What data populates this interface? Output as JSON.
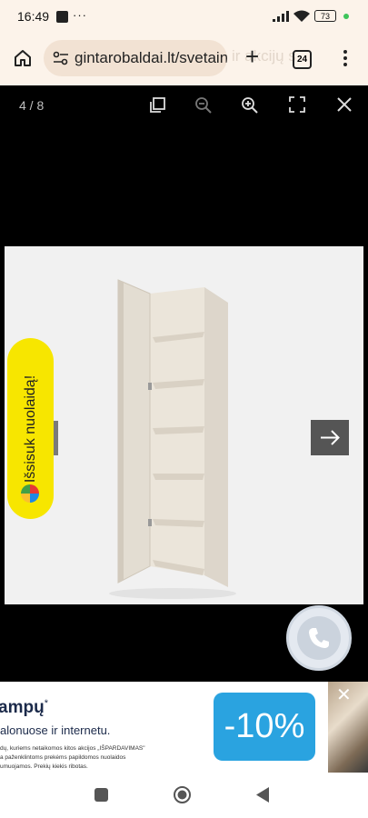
{
  "status_bar": {
    "time": "16:49",
    "dots": "···",
    "battery": "73"
  },
  "browser": {
    "url": "gintarobaldai.lt/svetain",
    "ghost_text": "ir akcijų s",
    "tab_count": "24",
    "new_tab": "+"
  },
  "lightbox": {
    "counter": "4 / 8"
  },
  "promo": {
    "label": "Išsisuk nuolaidą!"
  },
  "ad": {
    "title": "ampų",
    "title_mark": "*",
    "subtitle": "alonuose ir internetu.",
    "fine_print": [
      "dų, kuriems netaikomos kitos akcijos „IŠPARDAVIMAS\"",
      "a paženklintoms prekėms papildomos nuolaidos",
      "umuojamos. Prekių kiekis ribotas."
    ],
    "badge": "-10%"
  },
  "colors": {
    "browser_bg": "#fcf3ea",
    "promo_yellow": "#f7e600",
    "badge_blue": "#2aa3e0"
  }
}
